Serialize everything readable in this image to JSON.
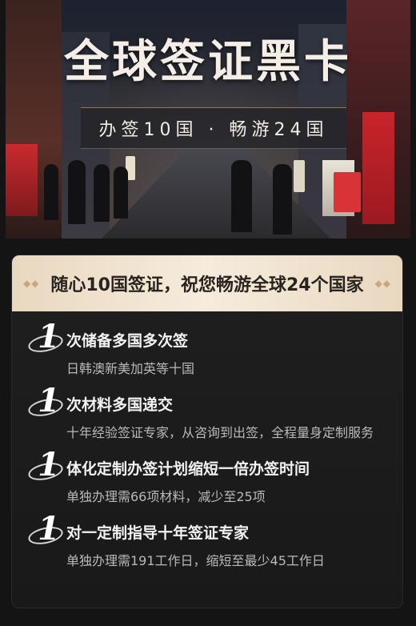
{
  "hero": {
    "title": "全球签证黑卡",
    "subtitle": "办签10国 · 畅游24国"
  },
  "card": {
    "header": "随心10国签证，祝您畅游全球24个国家",
    "header_decoration": "diamond-icons",
    "features": [
      {
        "number": "1",
        "title": "次储备多国多次签",
        "desc": "日韩澳新美加英等十国"
      },
      {
        "number": "1",
        "title": "次材料多国递交",
        "desc": "十年经验签证专家，从咨询到出签，全程量身定制服务"
      },
      {
        "number": "1",
        "title": "体化定制办签计划缩短一倍办签时间",
        "desc": "单独办理需66项材料，减少至25项"
      },
      {
        "number": "1",
        "title": "对一定制指导十年签证专家",
        "desc": "单独办理需191工作日，缩短至最少45工作日"
      }
    ]
  },
  "colors": {
    "background": "#141414",
    "card": "#1f1f1f",
    "header_gold": "#f6ecdc",
    "accent_gold": "#c9a97c"
  }
}
